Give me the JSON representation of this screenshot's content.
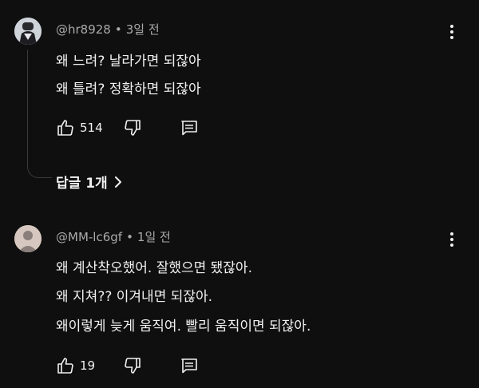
{
  "comments": [
    {
      "author": "@hr8928",
      "separator": "•",
      "time": "3일 전",
      "lines": [
        "왜 느려? 날라가면 되잖아",
        "왜 틀려? 정확하면 되잖아"
      ],
      "likes": "514",
      "replies_label": "답글 1개"
    },
    {
      "author": "@MM-lc6gf",
      "separator": "•",
      "time": "1일 전",
      "lines": [
        "왜 계산착오했어. 잘했으면 됐잖아.",
        "왜 지쳐?? 이겨내면 되잖아.",
        "왜이렇게 늦게 움직여. 빨리 움직이면 되잖아."
      ],
      "likes": "19"
    }
  ],
  "icons": {
    "like": "thumb-up-icon",
    "dislike": "thumb-down-icon",
    "reply": "comment-icon",
    "more": "more-vert-icon",
    "expand": "chevron-right-icon"
  },
  "colors": {
    "background": "#0f0f0f",
    "text": "#f1f1f1",
    "meta": "#aaaaaa"
  }
}
